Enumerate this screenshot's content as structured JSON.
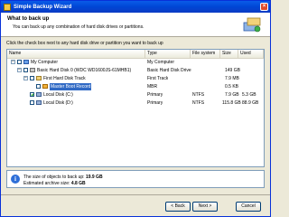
{
  "window": {
    "title": "Simple Backup Wizard"
  },
  "header": {
    "title": "What to back up",
    "subtitle": "You can back up any combination of hard disk drives or partitions."
  },
  "instruction": "Click the check box next to any hard disk drive or partition you want to back up",
  "table": {
    "columns": [
      "Name",
      "Type",
      "File system",
      "Size",
      "Used"
    ],
    "rows": [
      {
        "name": "My Computer",
        "type": "My Computer",
        "fs": "",
        "size": "",
        "used": "",
        "checked": false,
        "icon": "computer-icon"
      },
      {
        "name": "Basic Hard Disk 0 (WDC WD1600JS-61MHB1)",
        "type": "Basic Hard Disk Drive",
        "fs": "",
        "size": "149 GB",
        "used": "",
        "checked": false,
        "icon": "hard-disk-icon"
      },
      {
        "name": "First Hard Disk Track",
        "type": "First Track",
        "fs": "",
        "size": "7.9 MB",
        "used": "",
        "checked": false,
        "icon": "disk-track-icon"
      },
      {
        "name": "Master Boot Record",
        "type": "MBR",
        "fs": "",
        "size": "0.5 KB",
        "used": "",
        "checked": false,
        "icon": "mbr-icon"
      },
      {
        "name": "Local Disk (C:)",
        "type": "Primary",
        "fs": "NTFS",
        "size": "7.9 GB",
        "used": "5.3 GB",
        "checked": true,
        "icon": "partition-icon"
      },
      {
        "name": "Local Disk (D:)",
        "type": "Primary",
        "fs": "NTFS",
        "size": "115.8 GB",
        "used": "88.9 GB",
        "checked": false,
        "icon": "partition-icon"
      }
    ]
  },
  "summary": {
    "line1_label": "The size of objects to back up:",
    "line1_value": "19.9 GB",
    "line2_label": "Estimated archive size:",
    "line2_value": "4.8 GB"
  },
  "buttons": {
    "back": "< Back",
    "next": "Next >",
    "cancel": "Cancel"
  },
  "colors": {
    "titlebar": "#0046d5",
    "selection": "#316ac5",
    "window_bg": "#ece9d8"
  }
}
